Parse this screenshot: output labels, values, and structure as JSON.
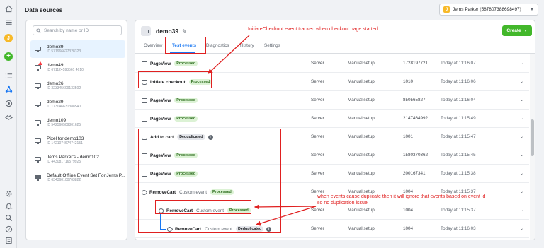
{
  "app": {
    "title": "Data sources"
  },
  "account": {
    "avatar_letter": "J",
    "label": "Jems Parker (587807388698497)"
  },
  "rail": {
    "avatar_letter": "J",
    "icons": [
      "home-icon",
      "menu-icon",
      "add-icon",
      "list-icon",
      "events-manager-icon",
      "settings-circle-icon",
      "partner-icon",
      "gear-icon",
      "bell-icon",
      "search-icon",
      "help-icon",
      "report-icon"
    ]
  },
  "sources": {
    "search_placeholder": "Search by name or ID",
    "items": [
      {
        "name": "demo39",
        "id": "ID 571966627328323",
        "warning": false,
        "selected": true,
        "icon": "monitor-icon"
      },
      {
        "name": "demo49",
        "id": "ID 671124593561 4610",
        "warning": true,
        "selected": false,
        "icon": "monitor-icon"
      },
      {
        "name": "demo26",
        "id": "ID 323345609133502",
        "warning": false,
        "selected": false,
        "icon": "monitor-icon"
      },
      {
        "name": "demo29",
        "id": "ID 173046631388540",
        "warning": false,
        "selected": false,
        "icon": "monitor-icon"
      },
      {
        "name": "demo109",
        "id": "ID 542560509801625",
        "warning": false,
        "selected": false,
        "icon": "monitor-icon"
      },
      {
        "name": "Pixel for demo103",
        "id": "ID 1421074674742151",
        "warning": false,
        "selected": false,
        "icon": "monitor-icon"
      },
      {
        "name": "Jems Parker's - demo102",
        "id": "ID 443081716579925",
        "warning": false,
        "selected": false,
        "icon": "monitor-icon"
      },
      {
        "name": "Default Offline Event Set For Jems P...",
        "id": "ID 634360100703822",
        "warning": false,
        "selected": false,
        "icon": "store-icon"
      }
    ]
  },
  "dataset": {
    "name": "demo39"
  },
  "create_button": "Create",
  "tabs": [
    "Overview",
    "Test events",
    "Diagnostics",
    "History",
    "Settings"
  ],
  "active_tab": "Test events",
  "events": [
    {
      "name": "PageView",
      "sub": "",
      "badge": "Processed",
      "badge_type": "proc",
      "source": "Server",
      "setup": "Manual setup",
      "value": "1728197721",
      "time": "Today at 11:16:07",
      "icon": "monitor-icon",
      "info": false
    },
    {
      "name": "Initiate checkout",
      "sub": "",
      "badge": "Processed",
      "badge_type": "proc",
      "source": "Server",
      "setup": "Manual setup",
      "value": "1010",
      "time": "Today at 11:16:06",
      "icon": "basket-icon",
      "info": false
    },
    {
      "name": "PageView",
      "sub": "",
      "badge": "Processed",
      "badge_type": "proc",
      "source": "Server",
      "setup": "Manual setup",
      "value": "850565827",
      "time": "Today at 11:16:04",
      "icon": "monitor-icon",
      "info": false
    },
    {
      "name": "PageView",
      "sub": "",
      "badge": "Processed",
      "badge_type": "proc",
      "source": "Server",
      "setup": "Manual setup",
      "value": "2147464992",
      "time": "Today at 11:15:49",
      "icon": "monitor-icon",
      "info": false
    },
    {
      "name": "Add to cart",
      "sub": "",
      "badge": "Deduplicated",
      "badge_type": "dup",
      "source": "Server",
      "setup": "Manual setup",
      "value": "1001",
      "time": "Today at 11:15:47",
      "icon": "cart-icon",
      "info": true
    },
    {
      "name": "PageView",
      "sub": "",
      "badge": "Processed",
      "badge_type": "proc",
      "source": "Server",
      "setup": "Manual setup",
      "value": "1580370362",
      "time": "Today at 11:15:45",
      "icon": "monitor-icon",
      "info": false
    },
    {
      "name": "PageView",
      "sub": "",
      "badge": "Processed",
      "badge_type": "proc",
      "source": "Server",
      "setup": "Manual setup",
      "value": "200167341",
      "time": "Today at 11:15:38",
      "icon": "monitor-icon",
      "info": false
    },
    {
      "name": "RemoveCart",
      "sub": "Custom event",
      "badge": "Processed",
      "badge_type": "proc",
      "source": "Server",
      "setup": "Manual setup",
      "value": "1004",
      "time": "Today at 11:15:37",
      "icon": "tag-icon",
      "info": false
    },
    {
      "name": "RemoveCart",
      "sub": "Custom event",
      "badge": "Processed",
      "badge_type": "proc",
      "source": "Server",
      "setup": "Manual setup",
      "value": "1004",
      "time": "Today at 11:15:37",
      "icon": "tag-icon",
      "info": false
    },
    {
      "name": "RemoveCart",
      "sub": "Custom event",
      "badge": "Deduplicated",
      "badge_type": "dup",
      "source": "Server",
      "setup": "Manual setup",
      "value": "1004",
      "time": "Today at 11:16:03",
      "icon": "tag-icon",
      "info": true
    }
  ],
  "annotations": {
    "checkout_note": "InitiateCheckout event tracked when checkout page started",
    "dedup_note_1": "when events cause duplicate then it will ignore that events based on event id",
    "dedup_note_2": "so no duplication issue"
  },
  "colors": {
    "accent": "#1877f2",
    "create": "#42b72a",
    "annotation": "#e02020",
    "processed_bg": "#dcf2d5"
  }
}
